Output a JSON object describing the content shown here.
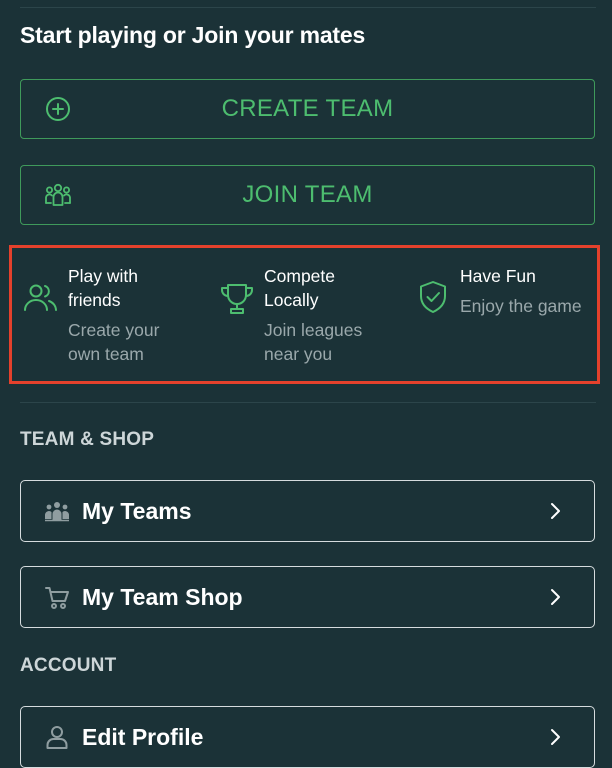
{
  "intro": {
    "title": "Start playing or Join your mates"
  },
  "actions": {
    "create": {
      "label": "CREATE TEAM",
      "icon": "plus-circle-icon"
    },
    "join": {
      "label": "JOIN TEAM",
      "icon": "group-icon"
    }
  },
  "features": [
    {
      "title": "Play with\nfriends",
      "subtitle": "Create your\nown team",
      "icon": "users-icon"
    },
    {
      "title": "Compete\nLocally",
      "subtitle": "Join leagues\nnear you",
      "icon": "trophy-icon"
    },
    {
      "title": "Have Fun",
      "subtitle": "Enjoy the game",
      "icon": "shield-check-icon"
    }
  ],
  "team_shop": {
    "heading": "TEAM & SHOP",
    "items": [
      {
        "label": "My Teams",
        "icon": "team-icon"
      },
      {
        "label": "My Team Shop",
        "icon": "cart-icon"
      }
    ]
  },
  "account": {
    "heading": "ACCOUNT",
    "items": [
      {
        "label": "Edit Profile",
        "icon": "user-icon"
      }
    ]
  },
  "colors": {
    "background": "#1b3237",
    "accent_green": "#4dbd6f",
    "highlight_border": "#e4412c",
    "muted_text": "#9aa8ab"
  }
}
